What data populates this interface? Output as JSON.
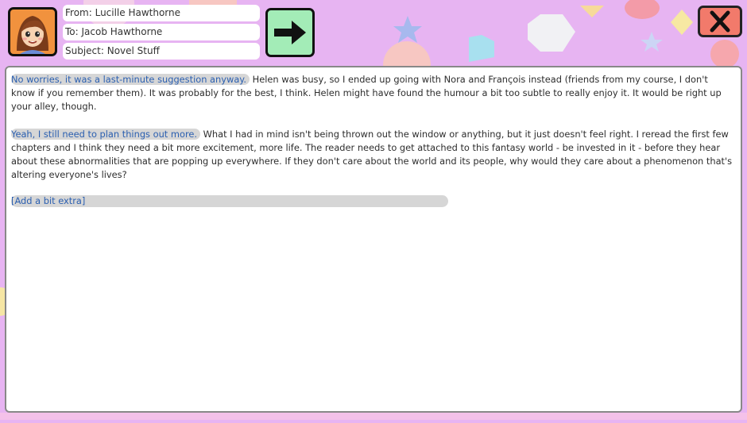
{
  "email": {
    "from": "From: Lucille Hawthorne",
    "to": "To: Jacob Hawthorne",
    "subject": "Subject: Novel Stuff"
  },
  "paragraphs": [
    {
      "choice": "No worries, it was a last-minute suggestion anyway.",
      "text": " Helen was busy, so I ended up going with Nora and François instead (friends from my course, I don't know if you remember them). It was probably for the best, I think. Helen might have found the humour a bit too subtle to really enjoy it. It would be right up your alley, though."
    },
    {
      "choice": "Yeah, I still need to plan things out more.",
      "text": " What I had in mind isn't being thrown out the window or anything, but it just doesn't feel right. I reread the first few chapters and I think they need a bit more excitement, more life. The reader needs to get attached to this fantasy world - be invested in it - before they hear about these abnormalities that are popping up everywhere. If they don't care about the world and its people, why would they care about a phenomenon that's altering everyone's lives?"
    }
  ],
  "add_extra_label": "[Add a bit extra]",
  "close_label": "X",
  "icons": {
    "avatar": "avatar-face-icon",
    "send": "right-arrow-icon",
    "close": "x-icon"
  },
  "colors": {
    "background": "#e7b4f2",
    "send_button": "#a3ecb7",
    "close_button": "#f27a6b",
    "avatar_bg": "#f1923e",
    "choice_text": "#2b5fb0"
  }
}
